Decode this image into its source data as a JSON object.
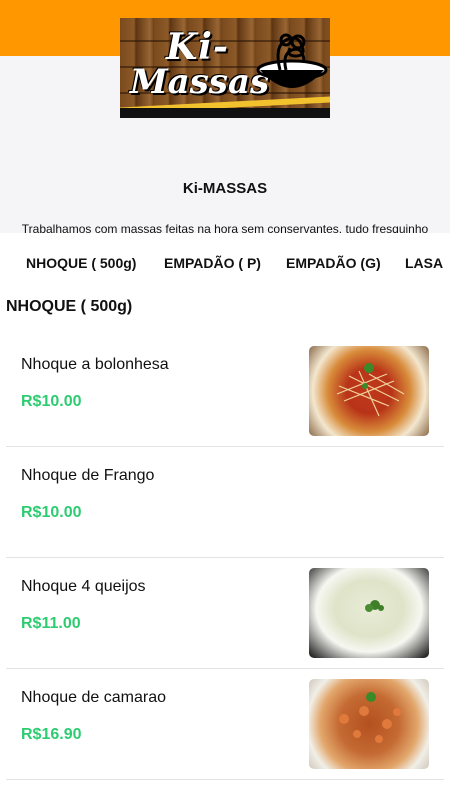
{
  "header": {
    "logo_line1": "Ki-",
    "logo_line2": "Massas",
    "brand_name": "Ki-MASSAS",
    "tagline": "Trabalhamos com massas feitas na hora sem conservantes, tudo fresquinho feito com muito capricho e amor para os nossos clientes !",
    "colors": {
      "top_bar": "#ff9800",
      "header_bg": "#f5f5f8",
      "price": "#2ecc71"
    }
  },
  "tabs": [
    {
      "label": "NHOQUE ( 500g)"
    },
    {
      "label": "EMPADÃO ( P)"
    },
    {
      "label": "EMPADÃO (G)"
    },
    {
      "label": "LASA"
    }
  ],
  "section": {
    "title": "NHOQUE ( 500g)"
  },
  "products": [
    {
      "name": "Nhoque a bolonhesa",
      "price": "R$10.00",
      "has_image": true
    },
    {
      "name": "Nhoque de Frango",
      "price": "R$10.00",
      "has_image": false
    },
    {
      "name": "Nhoque 4 queijos",
      "price": "R$11.00",
      "has_image": true
    },
    {
      "name": "Nhoque de camarao",
      "price": "R$16.90",
      "has_image": true
    }
  ]
}
